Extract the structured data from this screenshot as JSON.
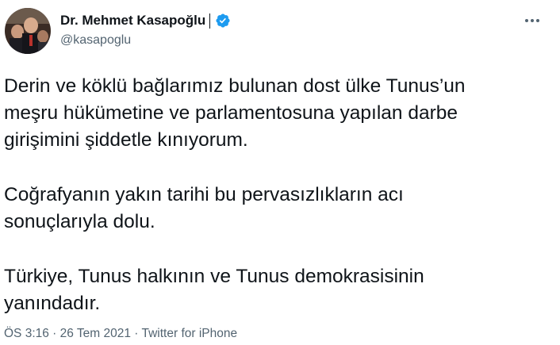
{
  "author": {
    "display_name": "Dr. Mehmet Kasapoğlu",
    "handle": "@kasapoglu",
    "verified": true,
    "avatar_icon": "profile-photo"
  },
  "tweet": {
    "paragraphs": [
      "Derin ve köklü bağlarımız bulunan dost ülke Tunus’un\nmeşru hükümetine ve parlamentosuna yapılan darbe\ngirişimini şiddetle kınıyorum.",
      "Coğrafyanın yakın tarihi bu pervasızlıkların acı\nsonuçlarıyla dolu.",
      "Türkiye, Tunus halkının ve Tunus demokrasisinin\nyanındadır."
    ]
  },
  "meta": {
    "time": "ÖS 3:16",
    "separator": " · ",
    "date": "26 Tem 2021",
    "source": "Twitter for iPhone"
  },
  "colors": {
    "text": "#0f1419",
    "secondary": "#536471",
    "verified": "#1d9bf0"
  }
}
